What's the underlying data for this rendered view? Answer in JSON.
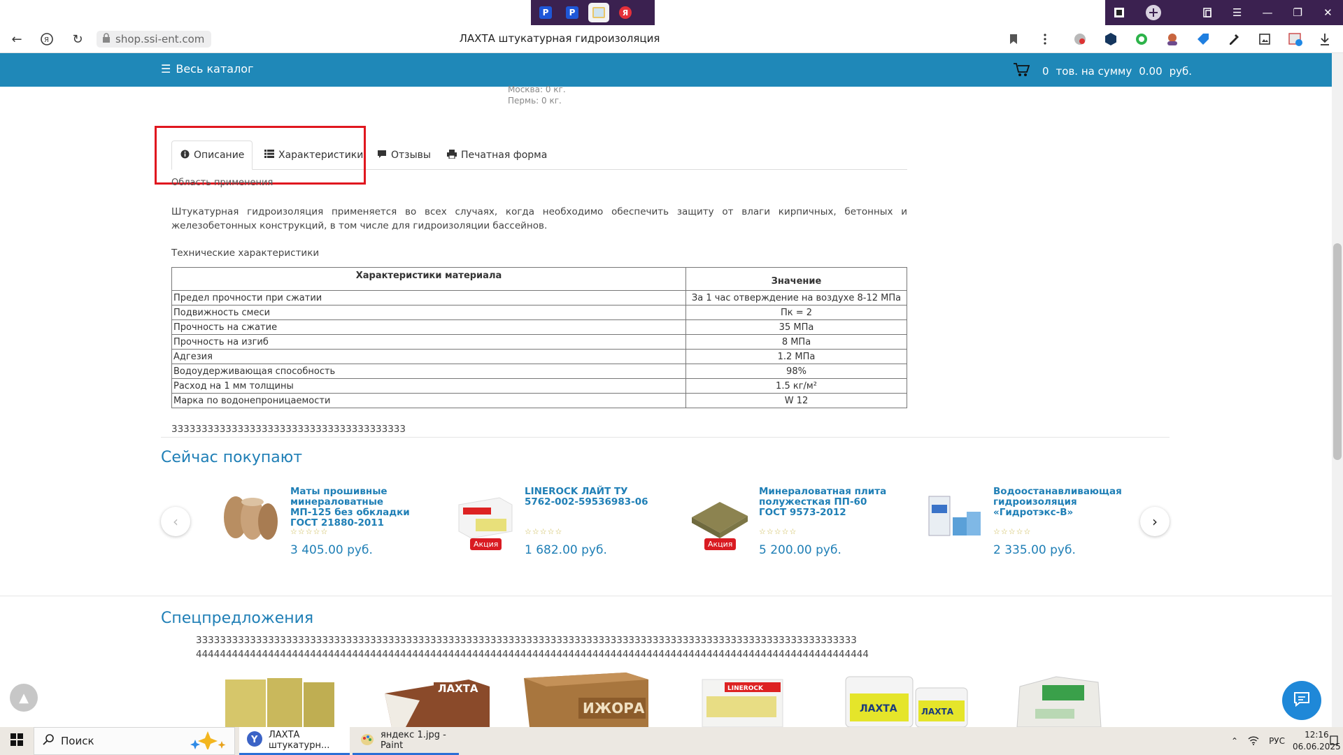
{
  "browser": {
    "tab_favicons": [
      "P",
      "P",
      "",
      "Я"
    ],
    "url": "shop.ssi-ent.com",
    "page_title": "ЛАХТА штукатурная гидроизоляция"
  },
  "header": {
    "catalog_label": "Весь каталог",
    "cart_count": "0",
    "cart_text": "тов. на сумму",
    "cart_sum": "0.00",
    "cart_currency": "руб."
  },
  "weights": {
    "line1": "Москва: 0 кг.",
    "line2": "Пермь: 0 кг."
  },
  "tabs": [
    {
      "label": "Описание",
      "icon": "info-icon"
    },
    {
      "label": "Характеристики",
      "icon": "list-icon"
    },
    {
      "label": "Отзывы",
      "icon": "comment-icon"
    },
    {
      "label": "Печатная форма",
      "icon": "print-icon"
    }
  ],
  "description": {
    "area_heading": "Область применения",
    "text": "Штукатурная гидроизоляция применяется во всех случаях, когда необходимо обеспечить защиту от влаги кирпичных, бетонных и железобетонных конструкций, в том числе для гидроизоляции бассейнов.",
    "tech_heading": "Технические характеристики",
    "table": {
      "headers": [
        "Характеристики материала",
        "Значение"
      ],
      "rows": [
        [
          "Предел прочности при сжатии",
          "За 1 час отверждение на воздухе 8-12 МПа"
        ],
        [
          "Подвижность смеси",
          "Пк = 2"
        ],
        [
          "Прочность на сжатие",
          "35 МПа"
        ],
        [
          "Прочность на изгиб",
          "8 МПа"
        ],
        [
          "Адгезия",
          "1.2 МПа"
        ],
        [
          "Водоудерживающая способность",
          "98%"
        ],
        [
          "Расход на 1 мм толщины",
          "1.5 кг/м²"
        ],
        [
          "Марка по водонепроницаемости",
          "W 12"
        ]
      ]
    },
    "notes": "333333333333333333333333333333333333333"
  },
  "now_buying": {
    "title": "Сейчас покупают",
    "products": [
      {
        "name": "Маты прошивные минераловатные МП-125 без обкладки ГОСТ 21880-2011",
        "price": "3 405.00 руб.",
        "badge": ""
      },
      {
        "name": "LINEROCK ЛАЙТ ТУ 5762-002-59536983-06",
        "price": "1 682.00 руб.",
        "badge": "Акция"
      },
      {
        "name": "Минераловатная плита полужесткая ПП-60 ГОСТ 9573-2012",
        "price": "5 200.00 руб.",
        "badge": "Акция"
      },
      {
        "name": "Водоостанавливающая гидроизоляция «Гидротэкс-В»",
        "price": "2 335.00 руб.",
        "badge": ""
      }
    ]
  },
  "special_offers": {
    "title": "Спецпредложения",
    "text1": "33333333333333333333333333333333333333333333333333333333333333333333333333333333333333333333333333333333333333",
    "text2": "4444444444444444444444444444444444444444444444444444444444444444444444444444444444444444444444444444444444444444",
    "images": [
      "ЛАХТА",
      "ИЖОРА",
      "LINEROCK",
      "ЛАХТА",
      "ЛАХТА"
    ]
  },
  "taskbar": {
    "search_placeholder": "Поиск",
    "apps": [
      {
        "label": "ЛАХТА штукатурн..."
      },
      {
        "label": "яндекс 1.jpg - Paint"
      }
    ],
    "lang": "РУС",
    "time": "12:16",
    "date": "06.06.2025"
  },
  "colors": {
    "header_blue": "#1f88b8",
    "link_blue": "#1f7fb6",
    "badge_red": "#d91b22",
    "highlight_red": "#e0171f",
    "chrome_purple": "#3b2150"
  }
}
